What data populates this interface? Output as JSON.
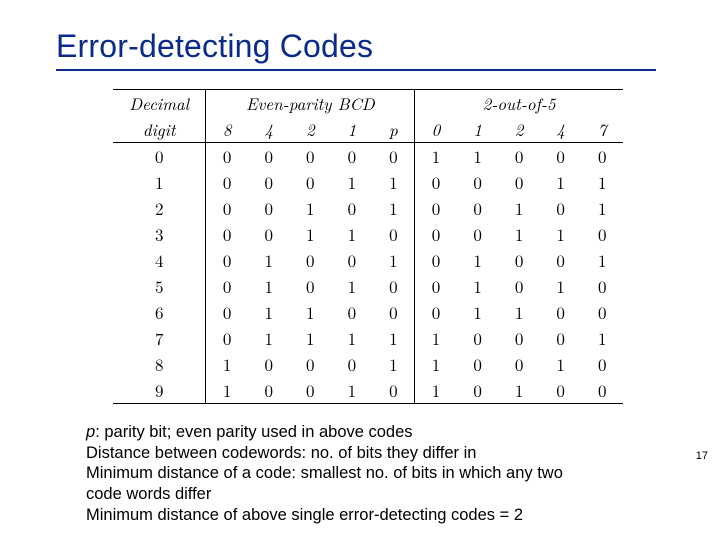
{
  "title": "Error-detecting Codes",
  "table": {
    "headers": {
      "decimal": "Decimal",
      "decimal_sub": "digit",
      "even_parity": "Even-parity BCD",
      "two_of_five": "2-out-of-5",
      "bcd_cols": [
        "8",
        "4",
        "2",
        "1"
      ],
      "p": "p",
      "five_cols": [
        "0",
        "1",
        "2",
        "4",
        "7"
      ]
    },
    "rows": [
      {
        "d": "0",
        "b": [
          "0",
          "0",
          "0",
          "0"
        ],
        "p": "0",
        "f": [
          "1",
          "1",
          "0",
          "0",
          "0"
        ]
      },
      {
        "d": "1",
        "b": [
          "0",
          "0",
          "0",
          "1"
        ],
        "p": "1",
        "f": [
          "0",
          "0",
          "0",
          "1",
          "1"
        ]
      },
      {
        "d": "2",
        "b": [
          "0",
          "0",
          "1",
          "0"
        ],
        "p": "1",
        "f": [
          "0",
          "0",
          "1",
          "0",
          "1"
        ]
      },
      {
        "d": "3",
        "b": [
          "0",
          "0",
          "1",
          "1"
        ],
        "p": "0",
        "f": [
          "0",
          "0",
          "1",
          "1",
          "0"
        ]
      },
      {
        "d": "4",
        "b": [
          "0",
          "1",
          "0",
          "0"
        ],
        "p": "1",
        "f": [
          "0",
          "1",
          "0",
          "0",
          "1"
        ]
      },
      {
        "d": "5",
        "b": [
          "0",
          "1",
          "0",
          "1"
        ],
        "p": "0",
        "f": [
          "0",
          "1",
          "0",
          "1",
          "0"
        ]
      },
      {
        "d": "6",
        "b": [
          "0",
          "1",
          "1",
          "0"
        ],
        "p": "0",
        "f": [
          "0",
          "1",
          "1",
          "0",
          "0"
        ]
      },
      {
        "d": "7",
        "b": [
          "0",
          "1",
          "1",
          "1"
        ],
        "p": "1",
        "f": [
          "1",
          "0",
          "0",
          "0",
          "1"
        ]
      },
      {
        "d": "8",
        "b": [
          "1",
          "0",
          "0",
          "0"
        ],
        "p": "1",
        "f": [
          "1",
          "0",
          "0",
          "1",
          "0"
        ]
      },
      {
        "d": "9",
        "b": [
          "1",
          "0",
          "0",
          "1"
        ],
        "p": "0",
        "f": [
          "1",
          "0",
          "1",
          "0",
          "0"
        ]
      }
    ]
  },
  "notes": {
    "p_sym": "p",
    "l1_rest": ": parity bit; even parity used in above codes",
    "l2": "Distance between codewords: no. of bits they differ in",
    "l3a": "Minimum distance of a code: smallest no. of bits in which any two",
    "l3b": "code words differ",
    "l4": "Minimum distance of above single error-detecting codes = 2"
  },
  "page": "17"
}
